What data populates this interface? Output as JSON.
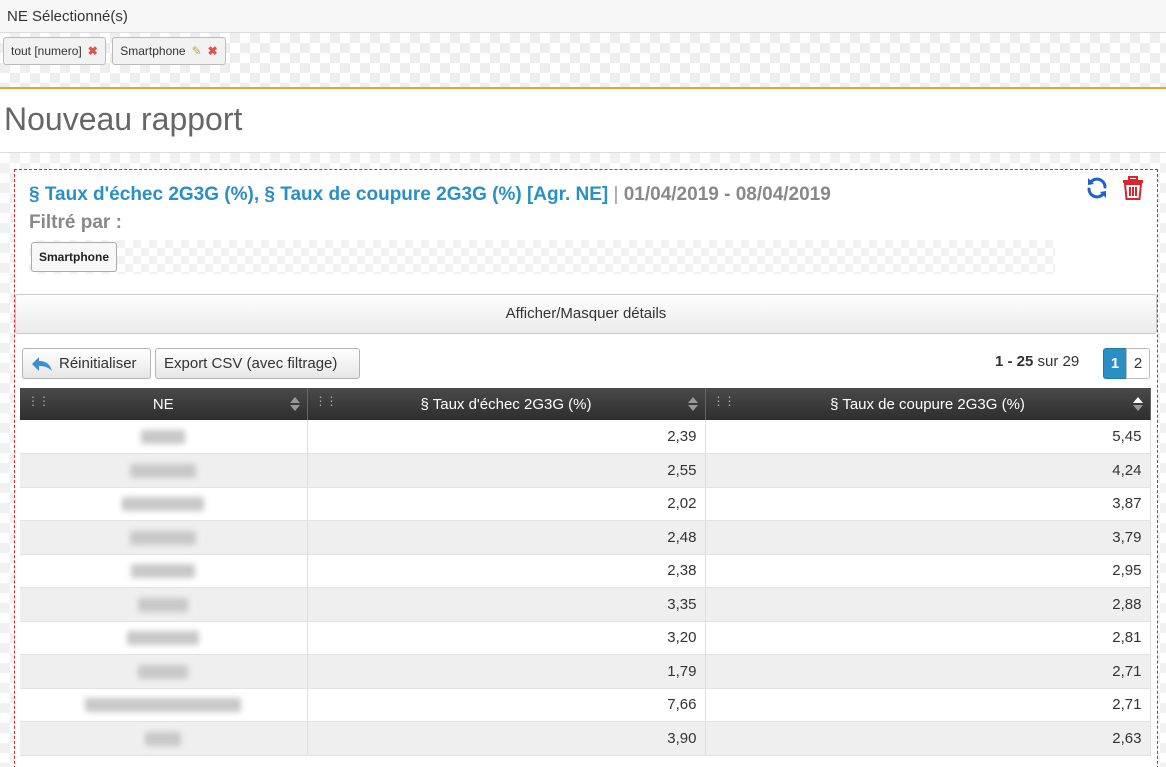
{
  "ne_panel": {
    "title": "NE Sélectionné(s)",
    "chips": [
      {
        "label": "tout [numero]"
      },
      {
        "label": "Smartphone"
      }
    ]
  },
  "page": {
    "title": "Nouveau rapport"
  },
  "report": {
    "kpi_title": "§ Taux d'échec 2G3G (%), § Taux de coupure 2G3G (%) [Agr. NE]",
    "separator": "|",
    "date_range": "01/04/2019 - 08/04/2019",
    "filter_label": "Filtré par :",
    "filter_chip": "Smartphone",
    "toggle_details": "Afficher/Masquer détails",
    "reset_button": "Réinitialiser",
    "export_button": "Export CSV (avec filtrage)",
    "pager": {
      "range": "1 - 25",
      "of_word": "sur",
      "total": "29",
      "pages": [
        "1",
        "2"
      ],
      "current": "1"
    },
    "columns": [
      "NE",
      "§ Taux d'échec 2G3G (%)",
      "§ Taux de coupure 2G3G (%)"
    ],
    "rows": [
      {
        "fail": "2,39",
        "drop": "5,45"
      },
      {
        "fail": "2,55",
        "drop": "4,24"
      },
      {
        "fail": "2,02",
        "drop": "3,87"
      },
      {
        "fail": "2,48",
        "drop": "3,79"
      },
      {
        "fail": "2,38",
        "drop": "2,95"
      },
      {
        "fail": "3,35",
        "drop": "2,88"
      },
      {
        "fail": "3,20",
        "drop": "2,81"
      },
      {
        "fail": "1,79",
        "drop": "2,71"
      },
      {
        "fail": "7,66",
        "drop": "2,71"
      },
      {
        "fail": "3,90",
        "drop": "2,63"
      }
    ]
  },
  "colors": {
    "accent": "#2a8fc5",
    "danger": "#d9262e",
    "orange": "#f0a030",
    "header_dark": "#3a3a3a"
  },
  "icons": [
    "remove-icon",
    "edit-pencil-icon",
    "refresh-icon",
    "trash-icon",
    "undo-arrow-icon",
    "sort-icon",
    "drag-grip-icon"
  ]
}
